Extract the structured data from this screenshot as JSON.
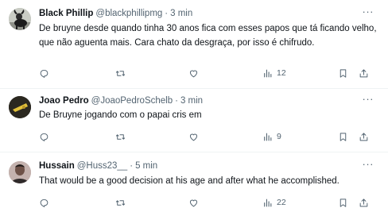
{
  "tweets": [
    {
      "name": "Black Phillip",
      "handle": "@blackphillipmg",
      "separator": "·",
      "time": "3 min",
      "text": "De bruyne desde quando tinha 30 anos fica com esses papos que tá ficando velho, que não aguenta mais. Cara chato da desgraça, por isso é chifrudo.",
      "views": "12",
      "avatar_color": "#b8bbb2"
    },
    {
      "name": "Joao Pedro",
      "handle": "@JoaoPedroSchelb",
      "separator": "·",
      "time": "3 min",
      "text": "De Bruyne jogando com o papai cris em",
      "views": "9",
      "avatar_color": "#2b2820"
    },
    {
      "name": "Hussain",
      "handle": "@Huss23__",
      "separator": "·",
      "time": "5 min",
      "text": "That would be a good decision at his age and after what he accomplished.",
      "views": "22",
      "avatar_color": "#b9a7a4"
    }
  ],
  "more_glyph": "···",
  "icons": [
    "reply-icon",
    "retweet-icon",
    "like-icon",
    "views-icon",
    "bookmark-icon",
    "share-icon"
  ]
}
